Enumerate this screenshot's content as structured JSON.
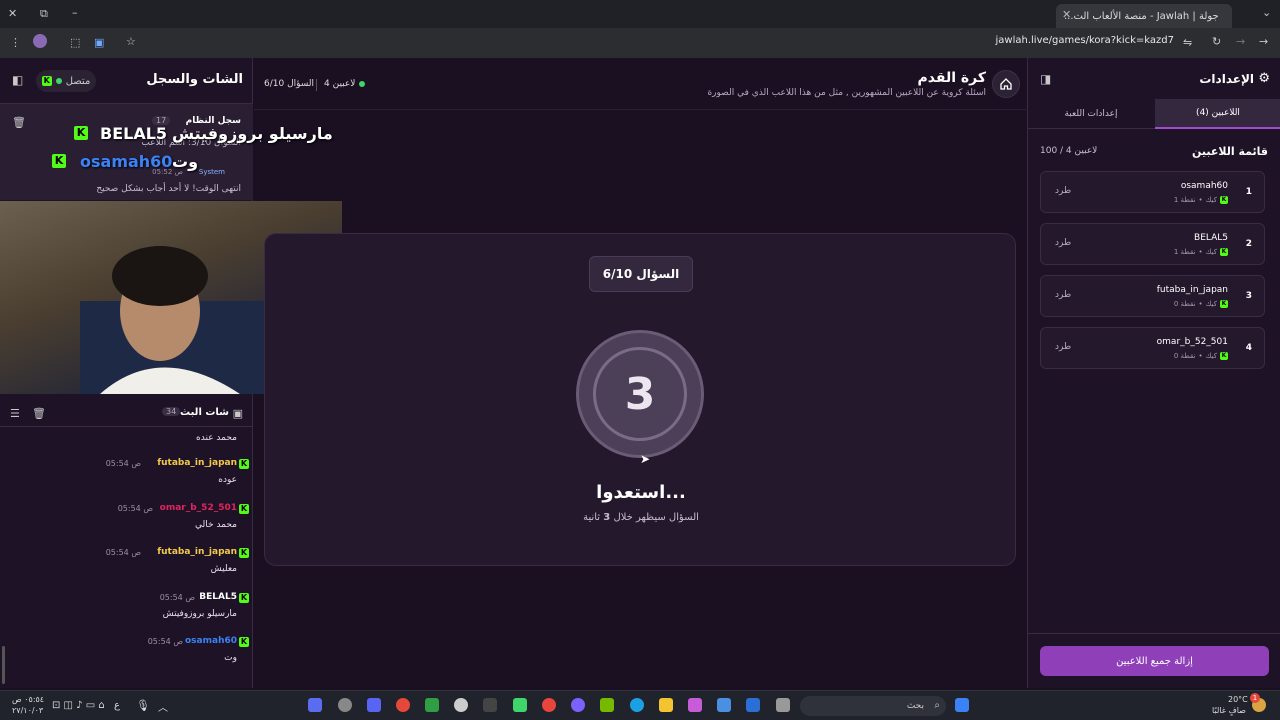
{
  "browser": {
    "tab_title": "جولة | Jawlah - منصة الألعاب الت...",
    "url": "jawlah.live/games/kora?kick=kazd7"
  },
  "chat_panel": {
    "title": "الشات والسجل",
    "status": "متصل",
    "system_log": {
      "title": "سجل النظام",
      "count": "17",
      "line1": "السؤال 3/10: اسم اللاعب",
      "sender": "System",
      "time": "05:52 ص",
      "line2": "انتهى الوقت! لا أحد أجاب بشكل صحيح"
    },
    "overlay": [
      {
        "user": "BELAL5",
        "text": "مارسيلو بروزوفيتش"
      },
      {
        "user": "osamah60",
        "text": "وت"
      }
    ],
    "stream_chat": {
      "title": "شات البث",
      "count": "34",
      "top_text": "محمد عنده",
      "messages": [
        {
          "user": "futaba_in_japan",
          "time": "05:54 ص",
          "text": "عوده",
          "color": "#f2c94c"
        },
        {
          "user": "omar_b_52_501",
          "time": "05:54 ص",
          "text": "محمد خالي",
          "color": "#e0245e"
        },
        {
          "user": "futaba_in_japan",
          "time": "05:54 ص",
          "text": "معليش",
          "color": "#f2c94c"
        },
        {
          "user": "BELAL5",
          "time": "05:54 ص",
          "text": "مارسيلو بروزوفيتش",
          "color": "#ffffff"
        },
        {
          "user": "osamah60",
          "time": "05:54 ص",
          "text": "وت",
          "color": "#3b82f6"
        }
      ]
    }
  },
  "game": {
    "title": "كرة القدم",
    "description": "اسئلة كروية عن اللاعبين المشهورين , مثل من هذا اللاعب الذي في الصورة",
    "question_progress": "السؤال 6/10",
    "players_online": "4 لاعبين",
    "question_badge": "السؤال 6/10",
    "countdown": "3",
    "ready_text": "استعدوا...",
    "soon_prefix": "السؤال سيظهر خلال",
    "soon_num": "3",
    "soon_suffix": "ثانية"
  },
  "settings": {
    "title": "الإعدادات",
    "tab_players": "اللاعبين (4)",
    "tab_game": "إعدادات اللعبة",
    "list_title": "قائمة اللاعبين",
    "list_count": "100 / 4 لاعبين",
    "kick_label": "طرد",
    "players": [
      {
        "num": "1",
        "name": "osamah60",
        "platform": "كيك",
        "points": "1 نقطة"
      },
      {
        "num": "2",
        "name": "BELAL5",
        "platform": "كيك",
        "points": "1 نقطة"
      },
      {
        "num": "3",
        "name": "futaba_in_japan",
        "platform": "كيك",
        "points": "0 نقطة"
      },
      {
        "num": "4",
        "name": "omar_b_52_501",
        "platform": "كيك",
        "points": "0 نقطة"
      }
    ],
    "remove_all": "إزالة جميع اللاعبين"
  },
  "taskbar": {
    "search_placeholder": "بحث",
    "weather_temp": "20°C",
    "weather_desc": "صافٍ غالبًا",
    "lang": "ع",
    "clock_time": "٠٥:٥٤ ص",
    "clock_date": "٢٧/١٠/٠٣",
    "notif_count": "1"
  },
  "colors": {
    "accent": "#8f3fb8",
    "kick_green": "#53fc18",
    "online_green": "#3fd56b"
  }
}
